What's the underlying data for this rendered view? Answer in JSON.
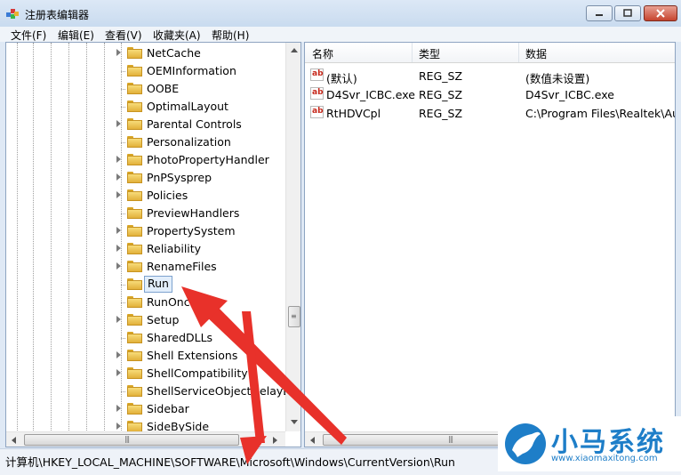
{
  "window": {
    "title": "注册表编辑器"
  },
  "menu": [
    {
      "label": "文件(F)"
    },
    {
      "label": "编辑(E)"
    },
    {
      "label": "查看(V)"
    },
    {
      "label": "收藏夹(A)"
    },
    {
      "label": "帮助(H)"
    }
  ],
  "tree": {
    "items": [
      {
        "label": "NetCache",
        "expandable": true,
        "selected": false
      },
      {
        "label": "OEMInformation",
        "expandable": false,
        "selected": false
      },
      {
        "label": "OOBE",
        "expandable": false,
        "selected": false
      },
      {
        "label": "OptimalLayout",
        "expandable": false,
        "selected": false
      },
      {
        "label": "Parental Controls",
        "expandable": true,
        "selected": false
      },
      {
        "label": "Personalization",
        "expandable": false,
        "selected": false
      },
      {
        "label": "PhotoPropertyHandler",
        "expandable": true,
        "selected": false
      },
      {
        "label": "PnPSysprep",
        "expandable": true,
        "selected": false
      },
      {
        "label": "Policies",
        "expandable": true,
        "selected": false
      },
      {
        "label": "PreviewHandlers",
        "expandable": false,
        "selected": false
      },
      {
        "label": "PropertySystem",
        "expandable": true,
        "selected": false
      },
      {
        "label": "Reliability",
        "expandable": true,
        "selected": false
      },
      {
        "label": "RenameFiles",
        "expandable": true,
        "selected": false
      },
      {
        "label": "Run",
        "expandable": false,
        "selected": true
      },
      {
        "label": "RunOnce",
        "expandable": false,
        "selected": false
      },
      {
        "label": "Setup",
        "expandable": true,
        "selected": false
      },
      {
        "label": "SharedDLLs",
        "expandable": false,
        "selected": false
      },
      {
        "label": "Shell Extensions",
        "expandable": true,
        "selected": false
      },
      {
        "label": "ShellCompatibility",
        "expandable": true,
        "selected": false
      },
      {
        "label": "ShellServiceObjectDelayLoad",
        "expandable": false,
        "selected": false
      },
      {
        "label": "Sidebar",
        "expandable": true,
        "selected": false
      },
      {
        "label": "SideBySide",
        "expandable": true,
        "selected": false
      }
    ]
  },
  "list": {
    "columns": {
      "name": "名称",
      "type": "类型",
      "data": "数据"
    },
    "rows": [
      {
        "name": "(默认)",
        "type": "REG_SZ",
        "data": "(数值未设置)"
      },
      {
        "name": "D4Svr_ICBC.exe",
        "type": "REG_SZ",
        "data": "D4Svr_ICBC.exe"
      },
      {
        "name": "RtHDVCpl",
        "type": "REG_SZ",
        "data": "C:\\Program Files\\Realtek\\Audio"
      }
    ]
  },
  "icons": {
    "value": "ab"
  },
  "status": {
    "path": "计算机\\HKEY_LOCAL_MACHINE\\SOFTWARE\\Microsoft\\Windows\\CurrentVersion\\Run"
  },
  "watermark": {
    "title": "小马系统",
    "url": "www.xiaomaxitong.com"
  },
  "colors": {
    "annotation_arrow": "#e8312a",
    "watermark": "#1e7ec8"
  }
}
